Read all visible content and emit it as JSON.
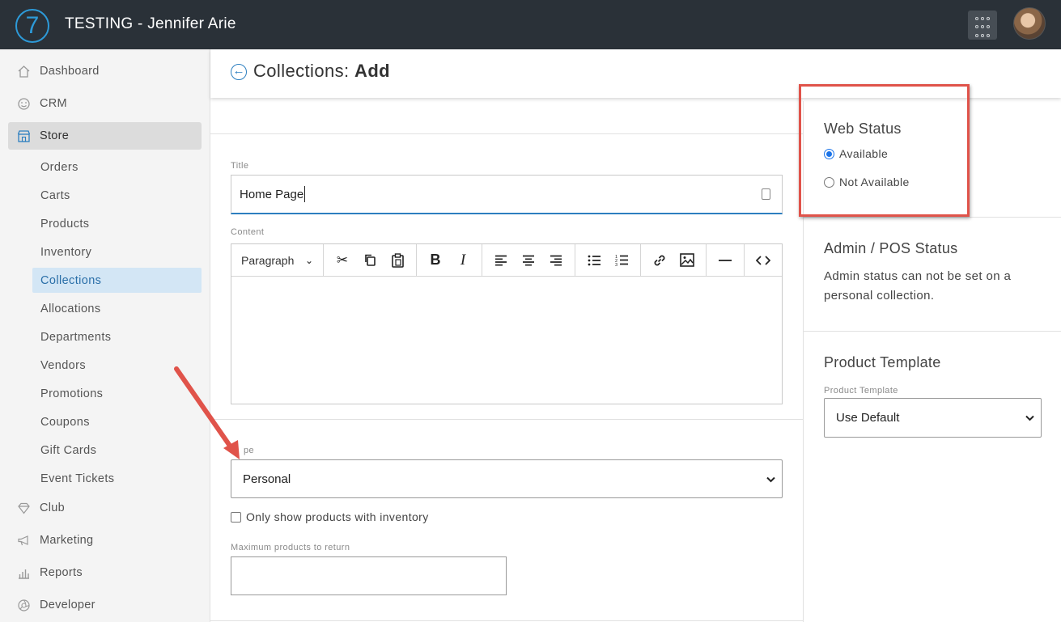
{
  "app": {
    "logo_text": "7",
    "title": "TESTING - Jennifer Arie"
  },
  "sidebar": {
    "items": [
      {
        "label": "Dashboard",
        "icon": "home-icon"
      },
      {
        "label": "CRM",
        "icon": "smiley-icon"
      },
      {
        "label": "Store",
        "icon": "store-icon",
        "active": true
      },
      {
        "label": "Club",
        "icon": "diamond-icon"
      },
      {
        "label": "Marketing",
        "icon": "megaphone-icon"
      },
      {
        "label": "Reports",
        "icon": "bar-chart-icon"
      },
      {
        "label": "Developer",
        "icon": "aperture-icon"
      }
    ],
    "store_subitems": [
      "Orders",
      "Carts",
      "Products",
      "Inventory",
      "Collections",
      "Allocations",
      "Departments",
      "Vendors",
      "Promotions",
      "Coupons",
      "Gift Cards",
      "Event Tickets"
    ],
    "active_subitem": "Collections"
  },
  "header": {
    "title_prefix": "Collections:",
    "title_action": "Add"
  },
  "form": {
    "title_label": "Title",
    "title_value": "Home Page",
    "content_label": "Content",
    "editor": {
      "block_format": "Paragraph"
    },
    "type_label_visible": "pe",
    "type_value": "Personal",
    "inventory_checkbox_label": "Only show products with inventory",
    "inventory_checked": false,
    "max_products_label": "Maximum products to return",
    "max_products_value": ""
  },
  "web_status": {
    "heading": "Web Status",
    "options": [
      {
        "label": "Available",
        "checked": true
      },
      {
        "label": "Not Available",
        "checked": false
      }
    ]
  },
  "admin_status": {
    "heading": "Admin / POS Status",
    "note": "Admin status can not be set on a personal collection."
  },
  "product_template": {
    "heading": "Product Template",
    "label": "Product Template",
    "value": "Use Default"
  },
  "colors": {
    "accent": "#2d7fc0",
    "topbar": "#2a3138",
    "annotation": "#e0534a"
  }
}
